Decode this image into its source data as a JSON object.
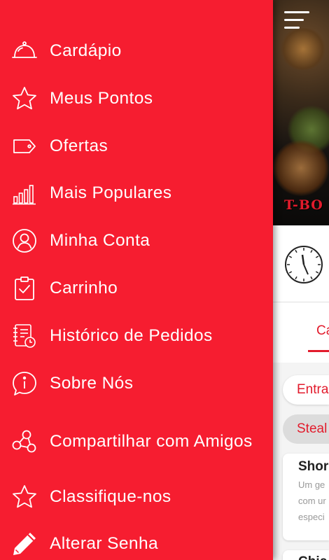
{
  "app": {
    "brand_text": "T-BO",
    "active_tab_label": "Ca",
    "category_chips": [
      "Entra",
      "Steal"
    ],
    "card": {
      "title": "Shor",
      "description_lines": [
        "Um ge",
        "com ur",
        "especi"
      ]
    },
    "card2_title": "Chic"
  },
  "drawer": {
    "background_color": "#f61d30",
    "items": [
      {
        "label": "Cardápio",
        "icon": "cloche-icon"
      },
      {
        "label": "Meus Pontos",
        "icon": "star-icon"
      },
      {
        "label": "Ofertas",
        "icon": "tag-icon"
      },
      {
        "label": "Mais Populares",
        "icon": "bar-chart-icon"
      },
      {
        "label": "Minha Conta",
        "icon": "user-circle-icon"
      },
      {
        "label": "Carrinho",
        "icon": "clipboard-check-icon"
      },
      {
        "label": "Histórico de Pedidos",
        "icon": "receipt-clock-icon"
      },
      {
        "label": "Sobre Nós",
        "icon": "info-bubble-icon"
      },
      {
        "label": "Compartilhar com Amigos",
        "icon": "share-icon"
      },
      {
        "label": "Classifique-nos",
        "icon": "star-outline-icon"
      },
      {
        "label": "Alterar Senha",
        "icon": "pencil-icon"
      }
    ]
  },
  "colors": {
    "accent": "#e21b2c",
    "drawer": "#f61d30"
  }
}
